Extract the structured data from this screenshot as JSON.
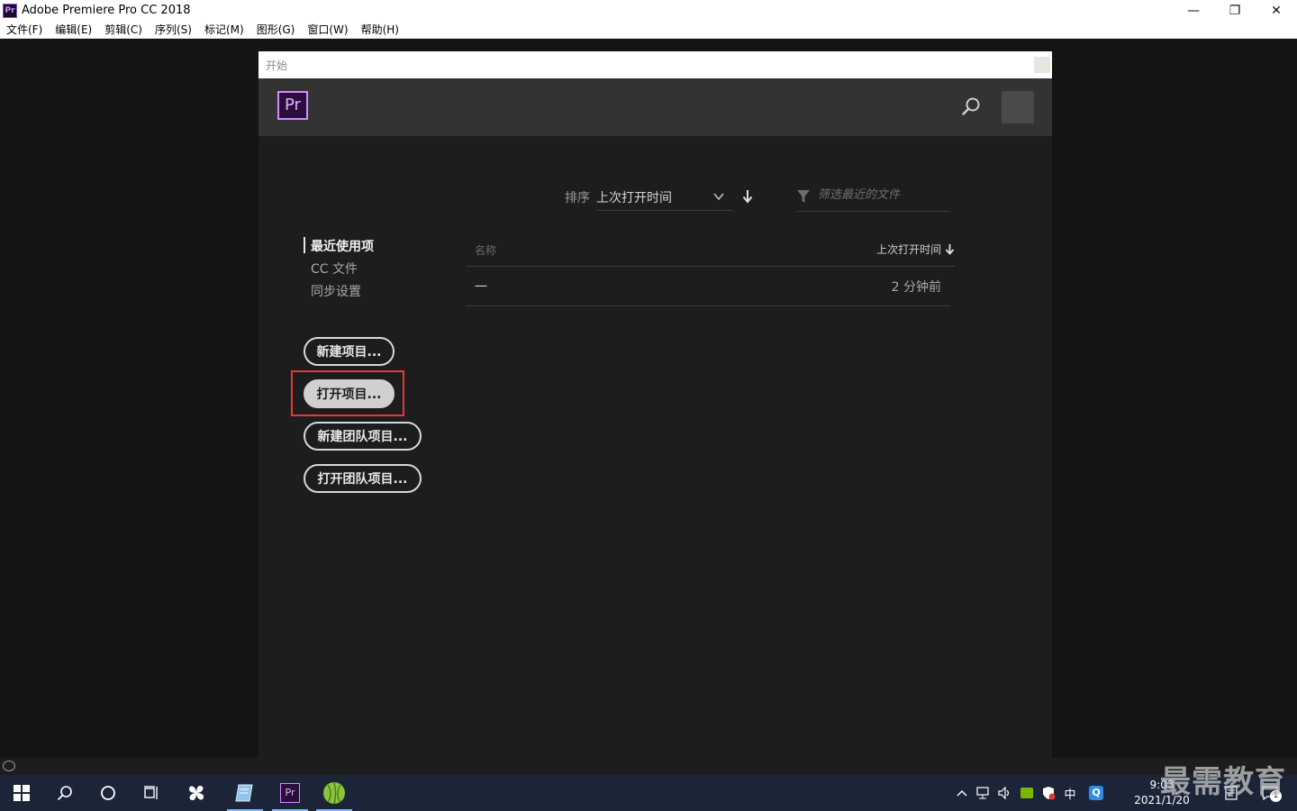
{
  "window": {
    "title": "Adobe Premiere Pro CC 2018",
    "app_icon": "Pr",
    "minimize": "—",
    "restore": "❐",
    "close": "✕"
  },
  "menu": [
    "文件(F)",
    "编辑(E)",
    "剪辑(C)",
    "序列(S)",
    "标记(M)",
    "图形(G)",
    "窗口(W)",
    "帮助(H)"
  ],
  "dialog": {
    "title": "开始",
    "logo": "Pr",
    "sort_label": "排序",
    "sort_value": "上次打开时间",
    "filter_placeholder": "筛选最近的文件",
    "nav": [
      {
        "label": "最近使用项",
        "active": true
      },
      {
        "label": "CC 文件",
        "active": false
      },
      {
        "label": "同步设置",
        "active": false
      }
    ],
    "buttons": {
      "new_project": "新建项目...",
      "open_project": "打开项目...",
      "new_team_project": "新建团队项目...",
      "open_team_project": "打开团队项目..."
    },
    "list": {
      "col_name": "名称",
      "col_time": "上次打开时间",
      "rows": [
        {
          "name": "一",
          "time": "2 分钟前"
        }
      ]
    }
  },
  "taskbar": {
    "ime": "中",
    "clock_time": "9:03",
    "clock_date": "2021/1/20",
    "notif_count": "1"
  },
  "watermark": "最需教育",
  "colors": {
    "accent_purple": "#d38bff",
    "highlight_red": "#e53935",
    "dialog_bg": "#1d1d1d",
    "header_bg": "#333333"
  }
}
